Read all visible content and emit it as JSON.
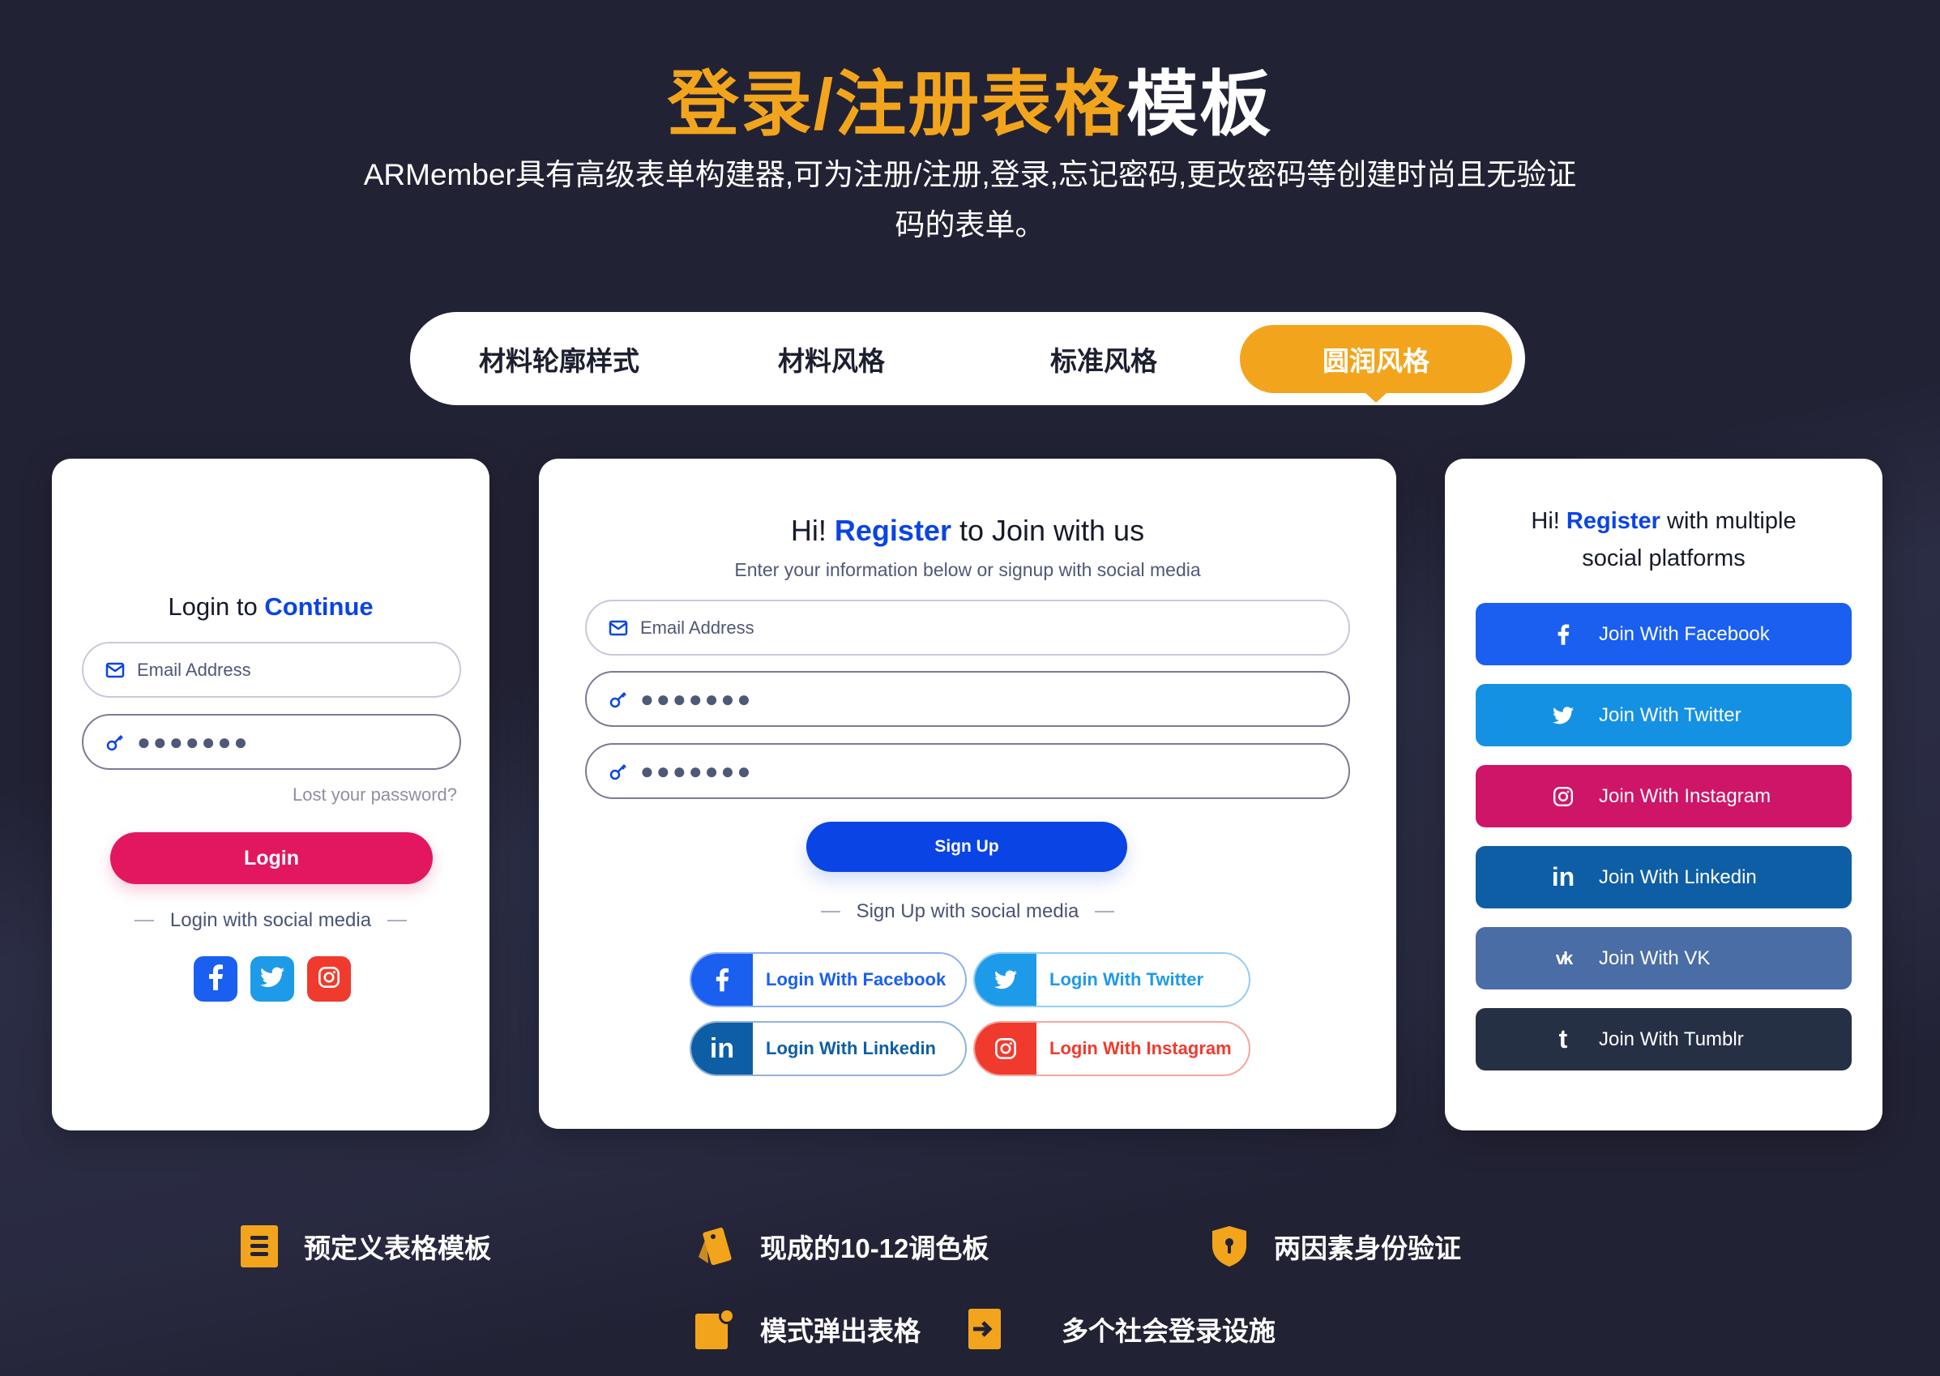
{
  "header": {
    "title_accent": "登录/注册表格",
    "title_rest": "模板",
    "subtitle": "ARMember具有高级表单构建器,可为注册/注册,登录,忘记密码,更改密码等创建时尚且无验证码的表单。"
  },
  "tabs": [
    {
      "label": "材料轮廓样式",
      "active": false
    },
    {
      "label": "材料风格",
      "active": false
    },
    {
      "label": "标准风格",
      "active": false
    },
    {
      "label": "圆润风格",
      "active": true
    }
  ],
  "login_card": {
    "heading_prefix": "Login to ",
    "heading_highlight": "Continue",
    "email_placeholder": "Email Address",
    "password_value": "●●●●●●●",
    "lost_password": "Lost your password?",
    "login_button": "Login",
    "social_divider": "Login with social media",
    "social_icons": [
      "facebook-icon",
      "twitter-icon",
      "instagram-icon"
    ]
  },
  "register_card": {
    "heading_prefix": "Hi! ",
    "heading_highlight": "Register",
    "heading_suffix": " to Join with us",
    "subheading": "Enter your information below or signup with social media",
    "email_placeholder": "Email Address",
    "password_value": "●●●●●●●",
    "confirm_password_value": "●●●●●●●",
    "signup_button": "Sign Up",
    "social_divider": "Sign Up with social media",
    "social_buttons": [
      {
        "label": "Login With Facebook",
        "icon": "facebook-icon",
        "color": "#1a5ff0"
      },
      {
        "label": "Login With Twitter",
        "icon": "twitter-icon",
        "color": "#1d9be8"
      },
      {
        "label": "Login With Linkedin",
        "icon": "linkedin-icon",
        "color": "#0e5ea5"
      },
      {
        "label": "Login With Instagram",
        "icon": "instagram-icon",
        "color": "#f03a2e"
      }
    ]
  },
  "social_card": {
    "heading_prefix": "Hi! ",
    "heading_highlight": "Register",
    "heading_suffix": " with multiple",
    "heading_line2": "social platforms",
    "buttons": [
      {
        "label": "Join With Facebook",
        "icon": "facebook-icon",
        "color": "#1a5ff0"
      },
      {
        "label": "Join With Twitter",
        "icon": "twitter-icon",
        "color": "#1591e3"
      },
      {
        "label": "Join With Instagram",
        "icon": "instagram-icon",
        "color": "#cf1567"
      },
      {
        "label": "Join With Linkedin",
        "icon": "linkedin-icon",
        "color": "#0e5ea5"
      },
      {
        "label": "Join With VK",
        "icon": "vk-icon",
        "color": "#4a6da6"
      },
      {
        "label": "Join With Tumblr",
        "icon": "tumblr-icon",
        "color": "#263045"
      }
    ]
  },
  "features": [
    {
      "label": "预定义表格模板",
      "icon": "document-list-icon"
    },
    {
      "label": "现成的10-12调色板",
      "icon": "color-palette-icon"
    },
    {
      "label": "两因素身份验证",
      "icon": "shield-lock-icon"
    },
    {
      "label": "模式弹出表格",
      "icon": "popup-form-icon"
    },
    {
      "label": "多个社会登录设施",
      "icon": "login-arrow-icon"
    }
  ],
  "colors": {
    "accent": "#f2a51c",
    "background": "#222235",
    "highlight_blue": "#0a44e4",
    "login_button": "#e3175f",
    "signup_button": "#0a44e4"
  }
}
